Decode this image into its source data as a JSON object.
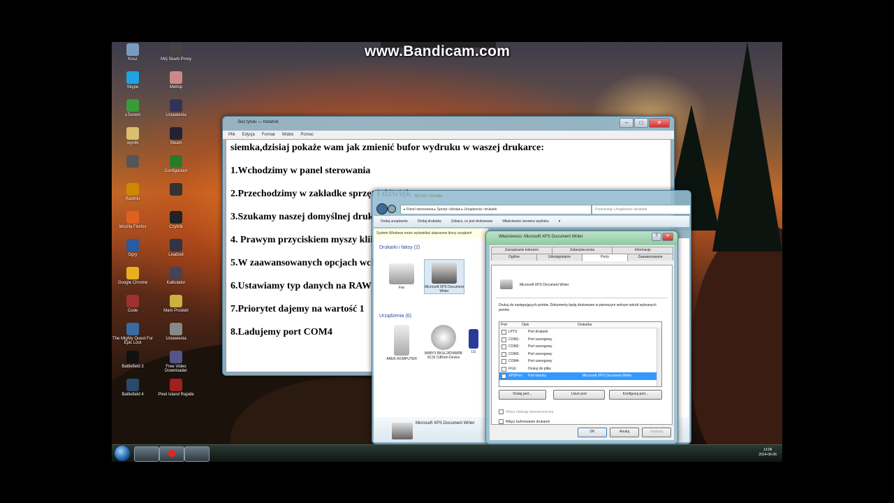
{
  "watermark": "www.Bandicam.com",
  "desktop_icons": [
    {
      "label": "Kosz",
      "color": "#7a9bc0"
    },
    {
      "label": "Mój Skarb Proxy",
      "color": "#444"
    },
    {
      "label": "Skype",
      "color": "#1fa3e0"
    },
    {
      "label": "Mettop",
      "color": "#c88"
    },
    {
      "label": "uTorrent",
      "color": "#3a9a3a"
    },
    {
      "label": "Ustawienia",
      "color": "#335"
    },
    {
      "label": "wyniki",
      "color": "#d8c070"
    },
    {
      "label": "Steam",
      "color": "#223"
    },
    {
      "label": "",
      "color": "#555"
    },
    {
      "label": "Configurator",
      "color": "#2a7a2a"
    },
    {
      "label": "Radmin",
      "color": "#c80"
    },
    {
      "label": "",
      "color": "#333"
    },
    {
      "label": "Mozilla Firefox",
      "color": "#e06020"
    },
    {
      "label": "Czytnik",
      "color": "#222"
    },
    {
      "label": "Ogry",
      "color": "#2a5aa0"
    },
    {
      "label": "Leadout",
      "color": "#334"
    },
    {
      "label": "Google Chrome",
      "color": "#e8b020"
    },
    {
      "label": "Kalkulator",
      "color": "#445"
    },
    {
      "label": "Code",
      "color": "#a03030"
    },
    {
      "label": "Mam Produkt",
      "color": "#ccb040"
    },
    {
      "label": "The Mighty Quest For Epic Loot",
      "color": "#3a6aa0"
    },
    {
      "label": "Ustawienia",
      "color": "#888"
    },
    {
      "label": "Battlefield 3",
      "color": "#111"
    },
    {
      "label": "Free Video Downloader",
      "color": "#558"
    },
    {
      "label": "Battlefield 4",
      "color": "#2a4a6a"
    },
    {
      "label": "Pixel Island Rapide",
      "color": "#a02020"
    }
  ],
  "notepad": {
    "title": "Bez tytułu — Notatnik",
    "menu": [
      "Plik",
      "Edycja",
      "Format",
      "Widok",
      "Pomoc"
    ],
    "lines": [
      "siemka,dzisiaj pokaże wam jak zmienić bufor wydruku w waszej drukarce:",
      "1.Wchodzimy w panel sterowania",
      "2.Przechodzimy w zakładke sprzęt i dźwięk",
      "3.Szukamy naszej domyślnej drukarki",
      "4. Prawym przyciskiem myszy klikamy właściwości",
      "5.W zaawansowanych opcjach wchodzimy w procesor wydruku",
      "6.Ustawiamy typ danych na RAW",
      "7.Priorytet dajemy na wartość 1",
      "8.Ladujemy port COM4"
    ]
  },
  "explorer": {
    "title": "Sprzęt i dźwięk",
    "address": "▸ Panel sterowania ▸ Sprzęt i dźwięk ▸ Urządzenia i drukarki",
    "search_placeholder": "Przeszukaj: Urządzenia i drukarki",
    "toolbar": [
      "Dodaj urządzenie",
      "Dodaj drukarkę",
      "Zobacz, co jest drukowane",
      "Właściwości serwera wydruku",
      "▾"
    ],
    "info": "System Windows może wyświetlać ulepszone ikony urządzeń",
    "group_printers": "Drukarki i faksy (2)",
    "group_devices": "Urządzenia (6)",
    "printers": [
      {
        "label": "Fax"
      },
      {
        "label": "Microsoft XPS Document Writer"
      }
    ],
    "devices": [
      {
        "label": "AREK-KOMPUTER"
      },
      {
        "label": "BABY3 RKUL2824WRB SCSI CdRom Device"
      },
      {
        "label": "LG"
      }
    ],
    "details_name": "Microsoft XPS Document Writer"
  },
  "props": {
    "title": "Właściwości: Microsoft XPS Document Writer",
    "tabs_top": [
      "Zarządzanie kolorami",
      "Zabezpieczenia",
      "Informacje"
    ],
    "tabs_bottom": [
      "Ogólne",
      "Udostępnianie",
      "Porty",
      "Zaawansowane"
    ],
    "active_tab": "Porty",
    "printer_name": "Microsoft XPS Document Writer",
    "desc": "Drukuj do następujących portów. Dokumenty będą drukowane w pierwszym wolnym wśród wybranych portów.",
    "columns": [
      "Port",
      "Opis",
      "Drukarka"
    ],
    "ports": [
      {
        "port": "LPT3:",
        "desc": "Port drukarki",
        "printer": "",
        "selected": false
      },
      {
        "port": "COM1:",
        "desc": "Port szeregowy",
        "printer": "",
        "selected": false
      },
      {
        "port": "COM2:",
        "desc": "Port szeregowy",
        "printer": "",
        "selected": false
      },
      {
        "port": "COM3:",
        "desc": "Port szeregowy",
        "printer": "",
        "selected": false
      },
      {
        "port": "COM4:",
        "desc": "Port szeregowy",
        "printer": "",
        "selected": false
      },
      {
        "port": "FILE:",
        "desc": "Drukuj do pliku",
        "printer": "",
        "selected": false
      },
      {
        "port": "XPSPort:",
        "desc": "Port lokalny",
        "printer": "Microsoft XPS Document Writer",
        "selected": true
      }
    ],
    "btn_add": "Dodaj port...",
    "btn_delete": "Usuń port",
    "btn_config": "Konfiguruj port...",
    "chk_bidi": "Włącz obsługę dwukierunkową",
    "chk_pool": "Włącz buforowanie drukarek",
    "btn_ok": "OK",
    "btn_cancel": "Anuluj",
    "btn_apply": "Zastosuj"
  },
  "taskbar": {
    "time": "13:06",
    "date": "2014-06-06"
  }
}
